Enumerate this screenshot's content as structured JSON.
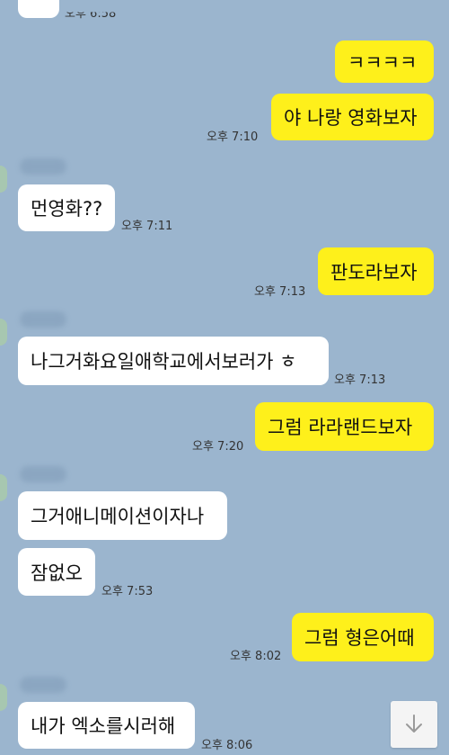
{
  "messages": [
    {
      "text": "ㅋㅋㅋㅋ",
      "side": "out"
    },
    {
      "text": "야 나랑 영화보자",
      "side": "out",
      "time": "오후 7:10"
    },
    {
      "text": "먼영화??",
      "side": "in",
      "time": "오후 7:11"
    },
    {
      "text": "판도라보자",
      "side": "out",
      "time": "오후 7:13"
    },
    {
      "text": "나그거화요일애학교에서보러가 ㅎ",
      "side": "in",
      "time": "오후 7:13"
    },
    {
      "text": "그럼 라라랜드보자",
      "side": "out",
      "time": "오후 7:20"
    },
    {
      "text": "그거애니메이션이자나",
      "side": "in"
    },
    {
      "text": "잠없오",
      "side": "in",
      "time": "오후 7:53"
    },
    {
      "text": "그럼 형은어때",
      "side": "out",
      "time": "오후 8:02"
    },
    {
      "text": "내가 엑소를시러해",
      "side": "in",
      "time": "오후 8:06"
    }
  ],
  "top_time_partial": "오후 6:58",
  "icons": {
    "scroll_down": "arrow-down-icon"
  },
  "colors": {
    "background": "#9bb5ce",
    "outgoing": "#fef01b",
    "incoming": "#ffffff"
  }
}
